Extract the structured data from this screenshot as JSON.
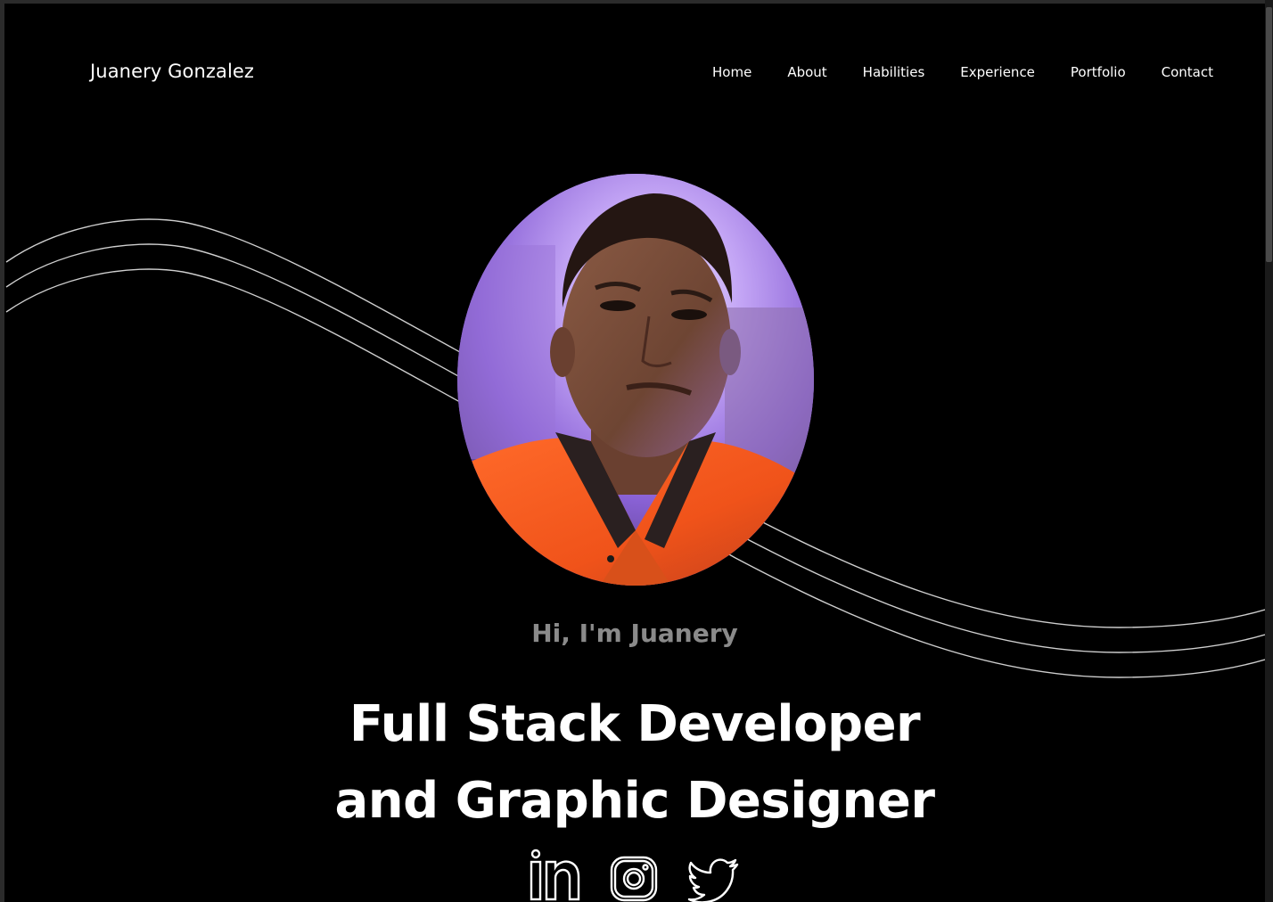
{
  "brand": {
    "name": "Juanery Gonzalez"
  },
  "nav": {
    "items": [
      "Home",
      "About",
      "Habilities",
      "Experience",
      "Portfolio",
      "Contact"
    ]
  },
  "hero": {
    "greeting": "Hi, I'm Juanery",
    "headline_line1": "Full Stack Developer",
    "headline_line2": "and Graphic Designer"
  },
  "social": {
    "icons": [
      "linkedin-icon",
      "instagram-icon",
      "twitter-icon"
    ]
  },
  "colors": {
    "background": "#000000",
    "text": "#ffffff",
    "greeting": "#8a8a8a",
    "wave": "#c8c8c8"
  }
}
